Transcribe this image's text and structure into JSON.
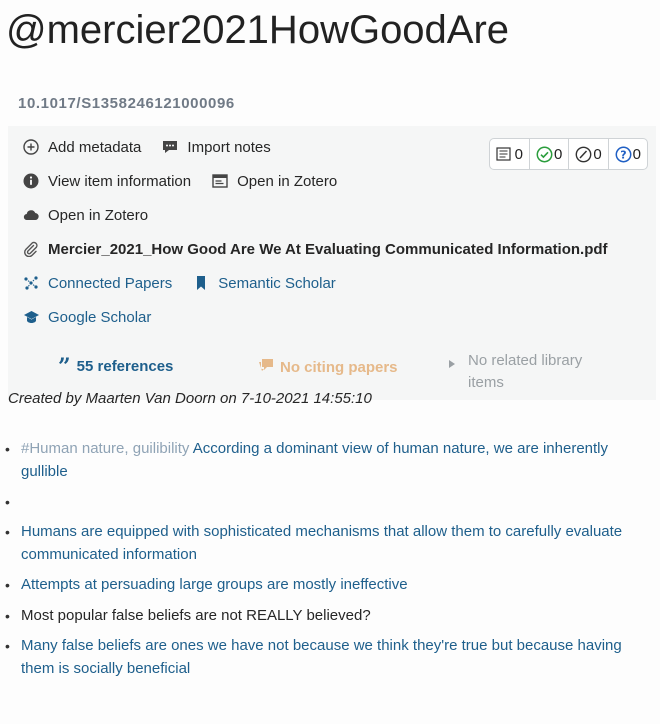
{
  "header": {
    "title": "@mercier2021HowGoodAre",
    "doi": "10.1017/S1358246121000096"
  },
  "actions": {
    "add_metadata": "Add metadata",
    "import_notes": "Import notes",
    "view_item_information": "View item information",
    "open_in_zotero_1": "Open in Zotero",
    "open_in_zotero_2": "Open in Zotero",
    "pdf_file": "Mercier_2021_How Good Are We At Evaluating Communicated Information.pdf",
    "connected_papers": "Connected Papers",
    "semantic_scholar": "Semantic Scholar",
    "google_scholar": "Google Scholar"
  },
  "badges": {
    "notes_count": "0",
    "checked_count": "0",
    "disputed_count": "0",
    "questions_count": "0"
  },
  "counts": {
    "references": "55 references",
    "citing": "No citing papers",
    "related": "No related library items"
  },
  "created": "Created by Maarten Van Doorn on 7-10-2021 14:55:10",
  "notes": {
    "item1_tag": "#Human nature, guilibility",
    "item1_text": "According a dominant view of human nature, we are inherently gullible",
    "item3_text": "Humans are equipped with sophisticated mechanisms that allow them to carefully evaluate communicated information",
    "item4_text": "Attempts at persuading large groups are mostly ineffective",
    "item5_text": "Most popular false beliefs are not REALLY believed?",
    "item6_text": "Many false beliefs are ones we have not because we think they're true but because having them is socially beneficial"
  },
  "colors": {
    "link": "#1e5f8c",
    "citing": "#e6b98a",
    "panel": "#f5f6f6"
  }
}
